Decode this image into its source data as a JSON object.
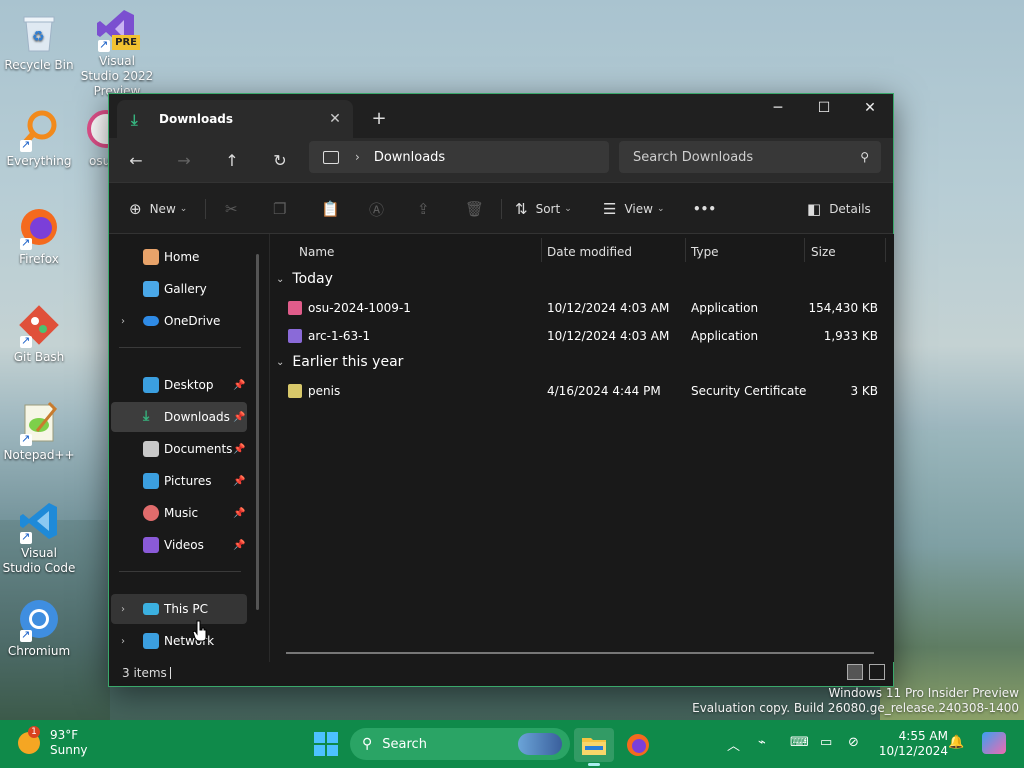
{
  "desktop": {
    "icons": [
      {
        "label": "Recycle Bin"
      },
      {
        "label": "Visual Studio 2022 Preview",
        "badge": "PRE"
      },
      {
        "label": "Everything"
      },
      {
        "label": "osu"
      },
      {
        "label": "Firefox"
      },
      {
        "label": "Git Bash"
      },
      {
        "label": "Notepad++"
      },
      {
        "label": "Visual Studio Code"
      },
      {
        "label": "Chromium"
      }
    ]
  },
  "explorer": {
    "tab_title": "Downloads",
    "address": {
      "crumb": "Downloads"
    },
    "search": {
      "placeholder": "Search Downloads"
    },
    "toolbar": {
      "new_label": "New",
      "sort_label": "Sort",
      "view_label": "View",
      "more_label": "•••",
      "details_label": "Details"
    },
    "sidebar": {
      "items": [
        {
          "label": "Home",
          "icon": "home-icon",
          "color": "#e8a36a"
        },
        {
          "label": "Gallery",
          "icon": "gallery-icon",
          "color": "#4aa8e8"
        },
        {
          "label": "OneDrive",
          "icon": "cloud-icon",
          "color": "#2f8be6"
        },
        {
          "label": "Desktop",
          "icon": "desktop-icon",
          "color": "#3b9fe0"
        },
        {
          "label": "Downloads",
          "icon": "download-icon",
          "color": "#36b37e"
        },
        {
          "label": "Documents",
          "icon": "document-icon",
          "color": "#c8c8c8"
        },
        {
          "label": "Pictures",
          "icon": "pictures-icon",
          "color": "#3b9fe0"
        },
        {
          "label": "Music",
          "icon": "music-icon",
          "color": "#e06c6c"
        },
        {
          "label": "Videos",
          "icon": "videos-icon",
          "color": "#8a5ad8"
        },
        {
          "label": "This PC",
          "icon": "pc-icon",
          "color": "#3bb0e0"
        },
        {
          "label": "Network",
          "icon": "network-icon",
          "color": "#3b9fe0"
        }
      ]
    },
    "columns": {
      "name": "Name",
      "date": "Date modified",
      "type": "Type",
      "size": "Size"
    },
    "groups": [
      {
        "label": "Today",
        "files": [
          {
            "name": "osu-2024-1009-1",
            "date": "10/12/2024 4:03 AM",
            "type": "Application",
            "size": "154,430 KB",
            "icon": "osu-icon",
            "color": "#e05c8a"
          },
          {
            "name": "arc-1-63-1",
            "date": "10/12/2024 4:03 AM",
            "type": "Application",
            "size": "1,933 KB",
            "icon": "arc-icon",
            "color": "#8a6ad8"
          }
        ]
      },
      {
        "label": "Earlier this year",
        "files": [
          {
            "name": "penis",
            "date": "4/16/2024 4:44 PM",
            "type": "Security Certificate",
            "size": "3 KB",
            "icon": "certificate-icon",
            "color": "#d8c86a"
          }
        ]
      }
    ],
    "status": {
      "item_count": "3 items"
    }
  },
  "watermark": {
    "line1": "Windows 11 Pro Insider Preview",
    "line2": "Evaluation copy. Build 26080.ge_release.240308-1400"
  },
  "taskbar": {
    "weather": {
      "temp": "93°F",
      "condition": "Sunny",
      "badge": "1"
    },
    "search_label": "Search",
    "clock": {
      "time": "4:55 AM",
      "date": "10/12/2024"
    }
  }
}
